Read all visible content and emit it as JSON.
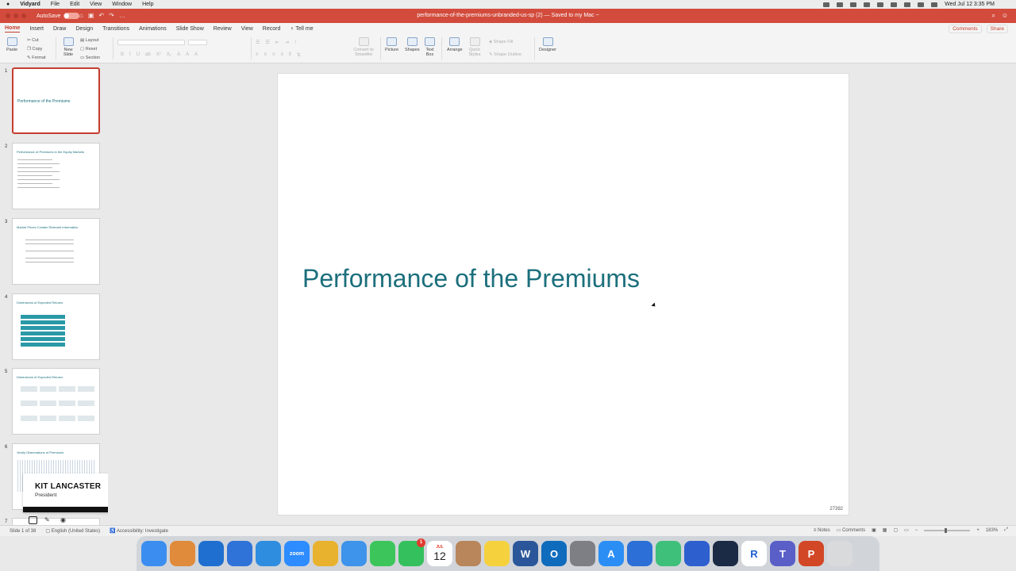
{
  "menubar": {
    "app_name": "Vidyard",
    "items": [
      "File",
      "Edit",
      "View",
      "Window",
      "Help"
    ],
    "clock": "Wed Jul 12  3:35 PM"
  },
  "titlebar": {
    "autosave_label": "AutoSave",
    "autosave_state": "OFF",
    "document_title": "performance-of-the-premiums-unbranded-us-sp (2) — Saved to my Mac ~"
  },
  "ribbon_tabs": {
    "tabs": [
      "Home",
      "Insert",
      "Draw",
      "Design",
      "Transitions",
      "Animations",
      "Slide Show",
      "Review",
      "View",
      "Record",
      "Tell me"
    ],
    "active": "Home",
    "comments_label": "Comments",
    "share_label": "Share"
  },
  "ribbon": {
    "paste": "Paste",
    "cut": "Cut",
    "copy": "Copy",
    "format": "Format",
    "new_slide": "New Slide",
    "layout": "Layout",
    "reset": "Reset",
    "section": "Section",
    "convert_smartart": "Convert to SmartArt",
    "picture": "Picture",
    "shapes": "Shapes",
    "text_box": "Text Box",
    "arrange": "Arrange",
    "quick_styles": "Quick Styles",
    "shape_fill": "Shape Fill",
    "shape_outline": "Shape Outline",
    "designer": "Designer",
    "format_buttons": [
      "B",
      "I",
      "U",
      "ab",
      "X²",
      "X₂",
      "A",
      "A",
      "A"
    ]
  },
  "slides_panel": {
    "slides": [
      {
        "num": "1",
        "title": "Performance of the Premiums"
      },
      {
        "num": "2",
        "title": "Performance of Premiums in the Equity Markets"
      },
      {
        "num": "3",
        "title": "Market Prices Contain Relevant Information"
      },
      {
        "num": "4",
        "title": "Dimensions of Expected Returns"
      },
      {
        "num": "5",
        "title": "Dimensions of Expected Returns"
      },
      {
        "num": "6",
        "title": "Yearly Observations of Premiums"
      },
      {
        "num": "7",
        "title": ""
      }
    ]
  },
  "presenter": {
    "name": "KIT LANCASTER",
    "role": "President"
  },
  "slide": {
    "title": "Performance of the Premiums",
    "footer_number": "27392"
  },
  "statusbar": {
    "slide_counter": "Slide 1 of 38",
    "language": "English (United States)",
    "accessibility": "Accessibility: Investigate",
    "notes": "Notes",
    "comments": "Comments",
    "zoom": "183%"
  },
  "dock": {
    "apps": [
      {
        "name": "Finder",
        "label": "",
        "color": "#3b8ef0"
      },
      {
        "name": "Launchpad",
        "label": "",
        "color": "#e08a3c"
      },
      {
        "name": "OneDrive",
        "label": "",
        "color": "#1f6fd0"
      },
      {
        "name": "Xcode",
        "label": "",
        "color": "#2f72d8"
      },
      {
        "name": "Safari",
        "label": "",
        "color": "#2f8de0"
      },
      {
        "name": "Zoom",
        "label": "zoom",
        "color": "#2d8cff"
      },
      {
        "name": "Chrome",
        "label": "",
        "color": "#e8b22e"
      },
      {
        "name": "Mail",
        "label": "",
        "color": "#3e93ea"
      },
      {
        "name": "Messages",
        "label": "",
        "color": "#3bc55a"
      },
      {
        "name": "FaceTime",
        "label": "",
        "color": "#34c05c",
        "badge": "1"
      },
      {
        "name": "Calendar",
        "label": "12",
        "month": "JUL",
        "color": "#ffffff"
      },
      {
        "name": "Contacts",
        "label": "",
        "color": "#b8865a"
      },
      {
        "name": "Notes",
        "label": "",
        "color": "#f5d13e"
      },
      {
        "name": "Word",
        "label": "W",
        "color": "#2b579a"
      },
      {
        "name": "Outlook",
        "label": "O",
        "color": "#0f6cbd"
      },
      {
        "name": "System Settings",
        "label": "",
        "color": "#7d7f84"
      },
      {
        "name": "App Store",
        "label": "A",
        "color": "#2a8ef5"
      },
      {
        "name": "Screen Share",
        "label": "",
        "color": "#2c6fd6"
      },
      {
        "name": "Android",
        "label": "",
        "color": "#3fc07a"
      },
      {
        "name": "Teams Directory",
        "label": "",
        "color": "#2d5fcf"
      },
      {
        "name": "Steam",
        "label": "",
        "color": "#1b2a45"
      },
      {
        "name": "Remote",
        "label": "R",
        "color": "#ffffff"
      },
      {
        "name": "Teams",
        "label": "T",
        "color": "#5a5fc8"
      },
      {
        "name": "PowerPoint",
        "label": "P",
        "color": "#d24726"
      },
      {
        "name": "Trash",
        "label": "",
        "color": "#d9dadc"
      }
    ]
  }
}
